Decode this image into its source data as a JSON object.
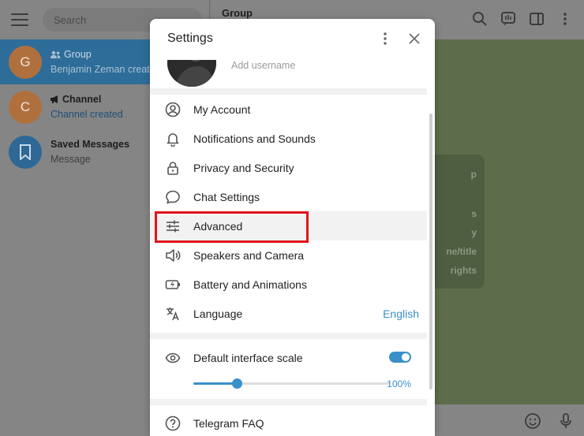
{
  "sidebar": {
    "search_placeholder": "Search",
    "chats": [
      {
        "initial": "G",
        "name": "Group",
        "preview": "Benjamin Zeman created",
        "active": true
      },
      {
        "initial": "C",
        "name": "Channel",
        "preview": "Channel created",
        "active": false
      },
      {
        "initial": "",
        "name": "Saved Messages",
        "preview": "Message",
        "active": false
      }
    ]
  },
  "main": {
    "title": "Group",
    "bubble_fragments": [
      "p",
      "s",
      "y",
      "ne/title",
      "rights"
    ]
  },
  "settings": {
    "title": "Settings",
    "username_hint": "Add username",
    "menu": [
      {
        "label": "My Account",
        "icon": "user-circle-icon"
      },
      {
        "label": "Notifications and Sounds",
        "icon": "bell-icon"
      },
      {
        "label": "Privacy and Security",
        "icon": "lock-icon"
      },
      {
        "label": "Chat Settings",
        "icon": "chat-bubble-icon"
      },
      {
        "label": "Advanced",
        "icon": "sliders-icon"
      },
      {
        "label": "Speakers and Camera",
        "icon": "speaker-icon"
      },
      {
        "label": "Battery and Animations",
        "icon": "battery-icon"
      },
      {
        "label": "Language",
        "icon": "translate-icon",
        "value": "English"
      }
    ],
    "scale": {
      "label": "Default interface scale",
      "enabled": true,
      "value_text": "100%",
      "slider_fraction": 0.22
    },
    "faq_label": "Telegram FAQ"
  },
  "colors": {
    "accent": "#3a90c9",
    "highlight_box": "#e0141c"
  }
}
